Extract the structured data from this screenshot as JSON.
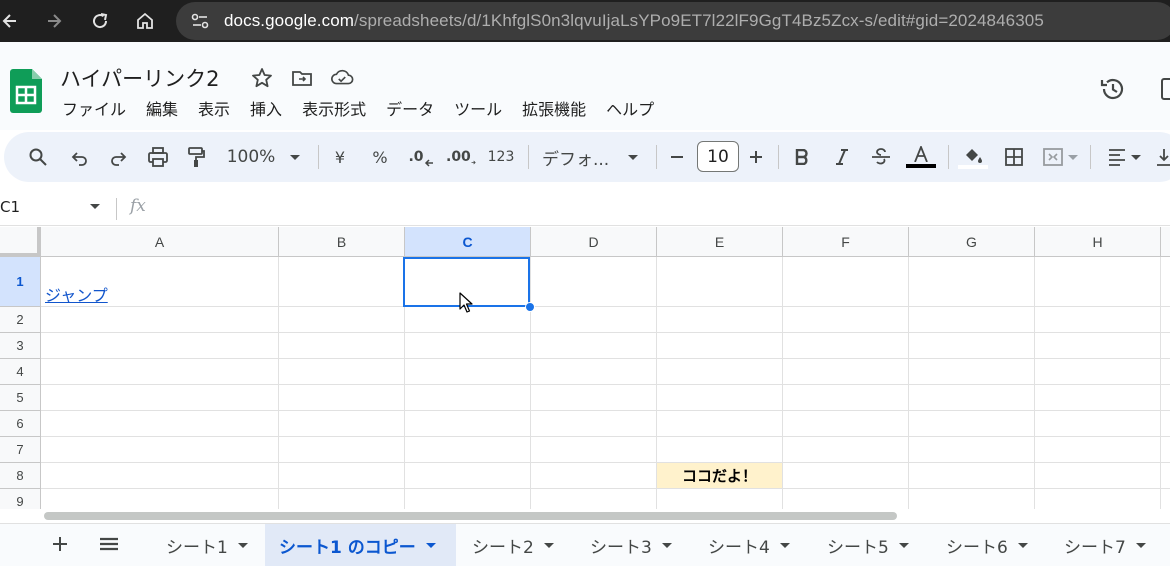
{
  "browser": {
    "url_domain": "docs.google.com",
    "url_path": "/spreadsheets/d/1KhfglS0n3lqvuIjaLsYPo9ET7l22lF9GgT4Bz5Zcx-s/edit#gid=2024846305"
  },
  "header": {
    "title": "ハイパーリンク2",
    "menus": [
      "ファイル",
      "編集",
      "表示",
      "挿入",
      "表示形式",
      "データ",
      "ツール",
      "拡張機能",
      "ヘルプ"
    ]
  },
  "toolbar": {
    "zoom": "100%",
    "currency": "¥",
    "percent": "%",
    "dec_decrease": ".0",
    "dec_increase": ".00",
    "number_format": "123",
    "font": "デフォ...",
    "font_size": "10"
  },
  "formula_bar": {
    "name_box": "C1",
    "fx": "fx"
  },
  "grid": {
    "columns": [
      "A",
      "B",
      "C",
      "D",
      "E",
      "F",
      "G",
      "H"
    ],
    "rows": [
      "1",
      "2",
      "3",
      "4",
      "5",
      "6",
      "7",
      "8",
      "9"
    ],
    "selected_column": "C",
    "selected_row": "1",
    "cell_a1": "ジャンプ",
    "cell_e8": "ココだよ！"
  },
  "sheets": {
    "tabs": [
      "シート1",
      "シート1 のコピー",
      "シート2",
      "シート3",
      "シート4",
      "シート5",
      "シート6",
      "シート7"
    ],
    "active_index": 1
  },
  "colors": {
    "link": "#1155cc",
    "selection": "#1a73e8",
    "highlight_cell": "#fff2cc",
    "active_tab": "#e1e9f7"
  }
}
